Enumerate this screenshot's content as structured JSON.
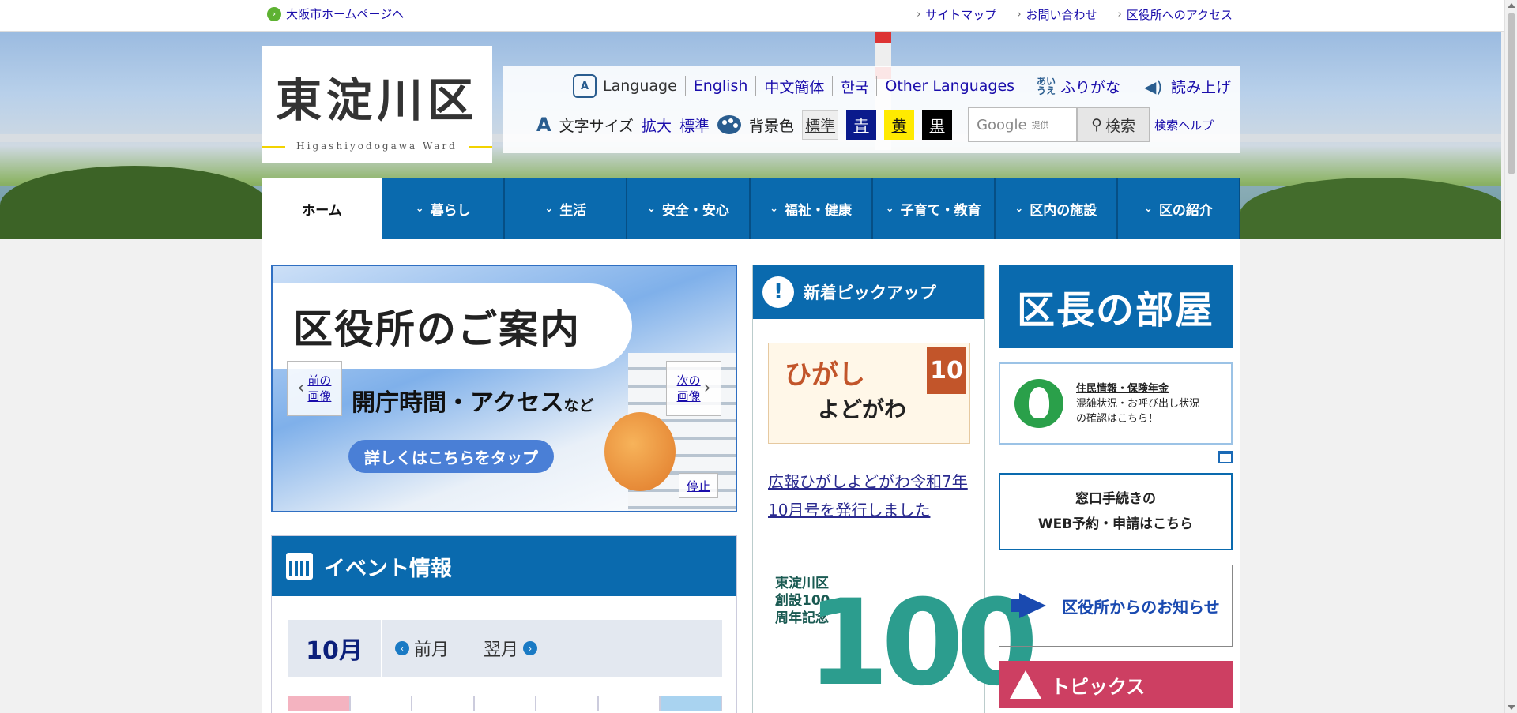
{
  "topbar": {
    "home_link": "大阪市ホームページへ",
    "util_links": [
      "サイトマップ",
      "お問い合わせ",
      "区役所へのアクセス"
    ]
  },
  "logo": {
    "kanji": "東淀川区",
    "roman": "Higashiyodogawa Ward"
  },
  "tools": {
    "language_label": "Language",
    "languages": [
      "English",
      "中文簡体",
      "한국",
      "Other Languages"
    ],
    "furigana": "ふりがな",
    "read_aloud": "読み上げ",
    "font_size_label": "文字サイズ",
    "font_enlarge": "拡大",
    "font_standard": "標準",
    "bg_label": "背景色",
    "bg_standard": "標準",
    "bg_blue": "青",
    "bg_yellow": "黄",
    "bg_black": "黒",
    "search_placeholder": "Google",
    "search_provider": "提供",
    "search_button": "検索",
    "search_help": "検索ヘルプ"
  },
  "nav": {
    "tabs": [
      "ホーム",
      "暮らし",
      "生活",
      "安全・安心",
      "福祉・健康",
      "子育て・教育",
      "区内の施設",
      "区の紹介"
    ]
  },
  "slider": {
    "headline": "区役所のご案内",
    "sub": "開庁時間・アクセス",
    "sub_suffix": "など",
    "cta": "詳しくはこちらをタップ",
    "prev_line1": "前の",
    "prev_line2": "画像",
    "next_line1": "次の",
    "next_line2": "画像",
    "stop": "停止"
  },
  "events": {
    "title": "イベント情報",
    "month": "10月",
    "prev_month": "前月",
    "next_month": "翌月"
  },
  "pickup": {
    "title": "新着ピックアップ",
    "thumb1_title": "ひがし",
    "thumb1_sub": "よどがわ",
    "thumb1_badge": "10",
    "link1": "広報ひがしよどがわ令和7年10月号を発行しました",
    "thumb2_text": "東淀川区創設100周年記念",
    "thumb2_number": "100"
  },
  "side": {
    "kucho": "区長の部屋",
    "juumin_title": "住民情報・保険年金",
    "juumin_line1": "混雑状況・お呼び出し状況",
    "juumin_line2": "の確認はこちら！",
    "madoguchi_line1": "窓口手続きの",
    "madoguchi_line2": "WEB予約・申請はこちら",
    "oshirase": "区役所からのお知らせ",
    "topics": "トピックス"
  },
  "colors": {
    "primary_blue": "#0a6aae",
    "topics_pink": "#cd3f62",
    "link": "#1a0dab"
  }
}
